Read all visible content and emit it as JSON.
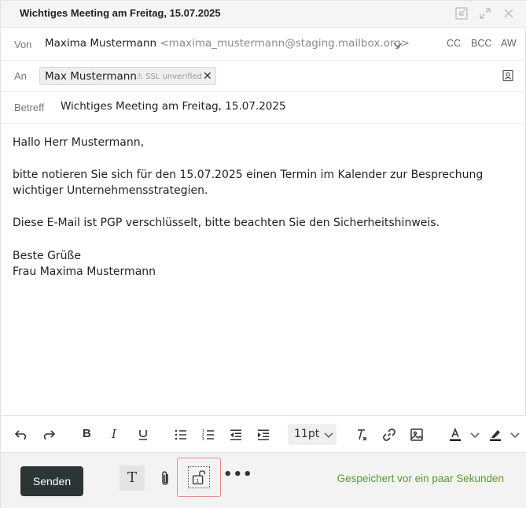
{
  "window": {
    "title": "Wichtiges Meeting am Freitag, 15.07.2025"
  },
  "header": {
    "from_label": "Von",
    "from_name": "Maxima Mustermann",
    "from_email": "<maxima_mustermann@staging.mailbox.org>",
    "cc_label": "CC",
    "bcc_label": "BCC",
    "aw_label": "AW",
    "to_label": "An",
    "recipient_name": "Max Mustermann",
    "recipient_warning": "⚠ SSL unverified",
    "subject_label": "Betreff",
    "subject": "Wichtiges Meeting am Freitag, 15.07.2025"
  },
  "body": {
    "lines": [
      "Hallo Herr Mustermann,",
      "bitte notieren Sie sich für den 15.07.2025 einen Termin im Kalender zur Besprechung",
      "wichtiger Unternehmensstrategien.",
      "Diese E-Mail ist PGP verschlüsselt, bitte beachten Sie den Sicherheitshinweis.",
      "Beste Grüße",
      "Frau Maxima Mustermann"
    ]
  },
  "toolbar": {
    "font_size": "11pt",
    "icons": [
      "undo-icon",
      "redo-icon",
      "bold-icon",
      "italic-icon",
      "underline-icon",
      "bullet-list-icon",
      "numbered-list-icon",
      "outdent-icon",
      "indent-icon",
      "clear-format-icon",
      "link-icon",
      "image-icon",
      "text-color-icon",
      "highlight-icon"
    ]
  },
  "footer": {
    "send_label": "Senden",
    "text_format_glyph": "T",
    "more_glyph": "•••",
    "saved_status": "Gespeichert vor ein paar Sekunden"
  },
  "colors": {
    "send_button": "#2d3436",
    "saved_status": "#5c9a2e",
    "highlight_box": "#e8898a"
  }
}
